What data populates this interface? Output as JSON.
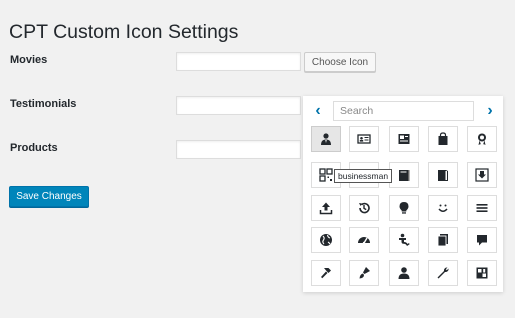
{
  "page": {
    "title": "CPT Custom Icon Settings"
  },
  "rows": [
    {
      "label": "Movies",
      "value": ""
    },
    {
      "label": "Testimonials",
      "value": ""
    },
    {
      "label": "Products",
      "value": ""
    }
  ],
  "buttons": {
    "choose_icon": "Choose Icon",
    "save": "Save Changes"
  },
  "picker": {
    "prev": "‹",
    "next": "›",
    "search_placeholder": "Search",
    "tooltip": "businessman",
    "icons": [
      "businessman",
      "id-card",
      "id-card-alt",
      "shopping-bag",
      "award",
      "qr-code",
      "translation",
      "book",
      "book-alt",
      "download",
      "upload",
      "backup",
      "lightbulb",
      "smiley",
      "menu",
      "globe",
      "performance",
      "universal-access",
      "pages",
      "comment",
      "hammer",
      "art",
      "person",
      "wrench",
      "archive"
    ]
  },
  "colors": {
    "primary": "#0085ba",
    "link": "#0073aa",
    "background": "#f1f1f1"
  }
}
